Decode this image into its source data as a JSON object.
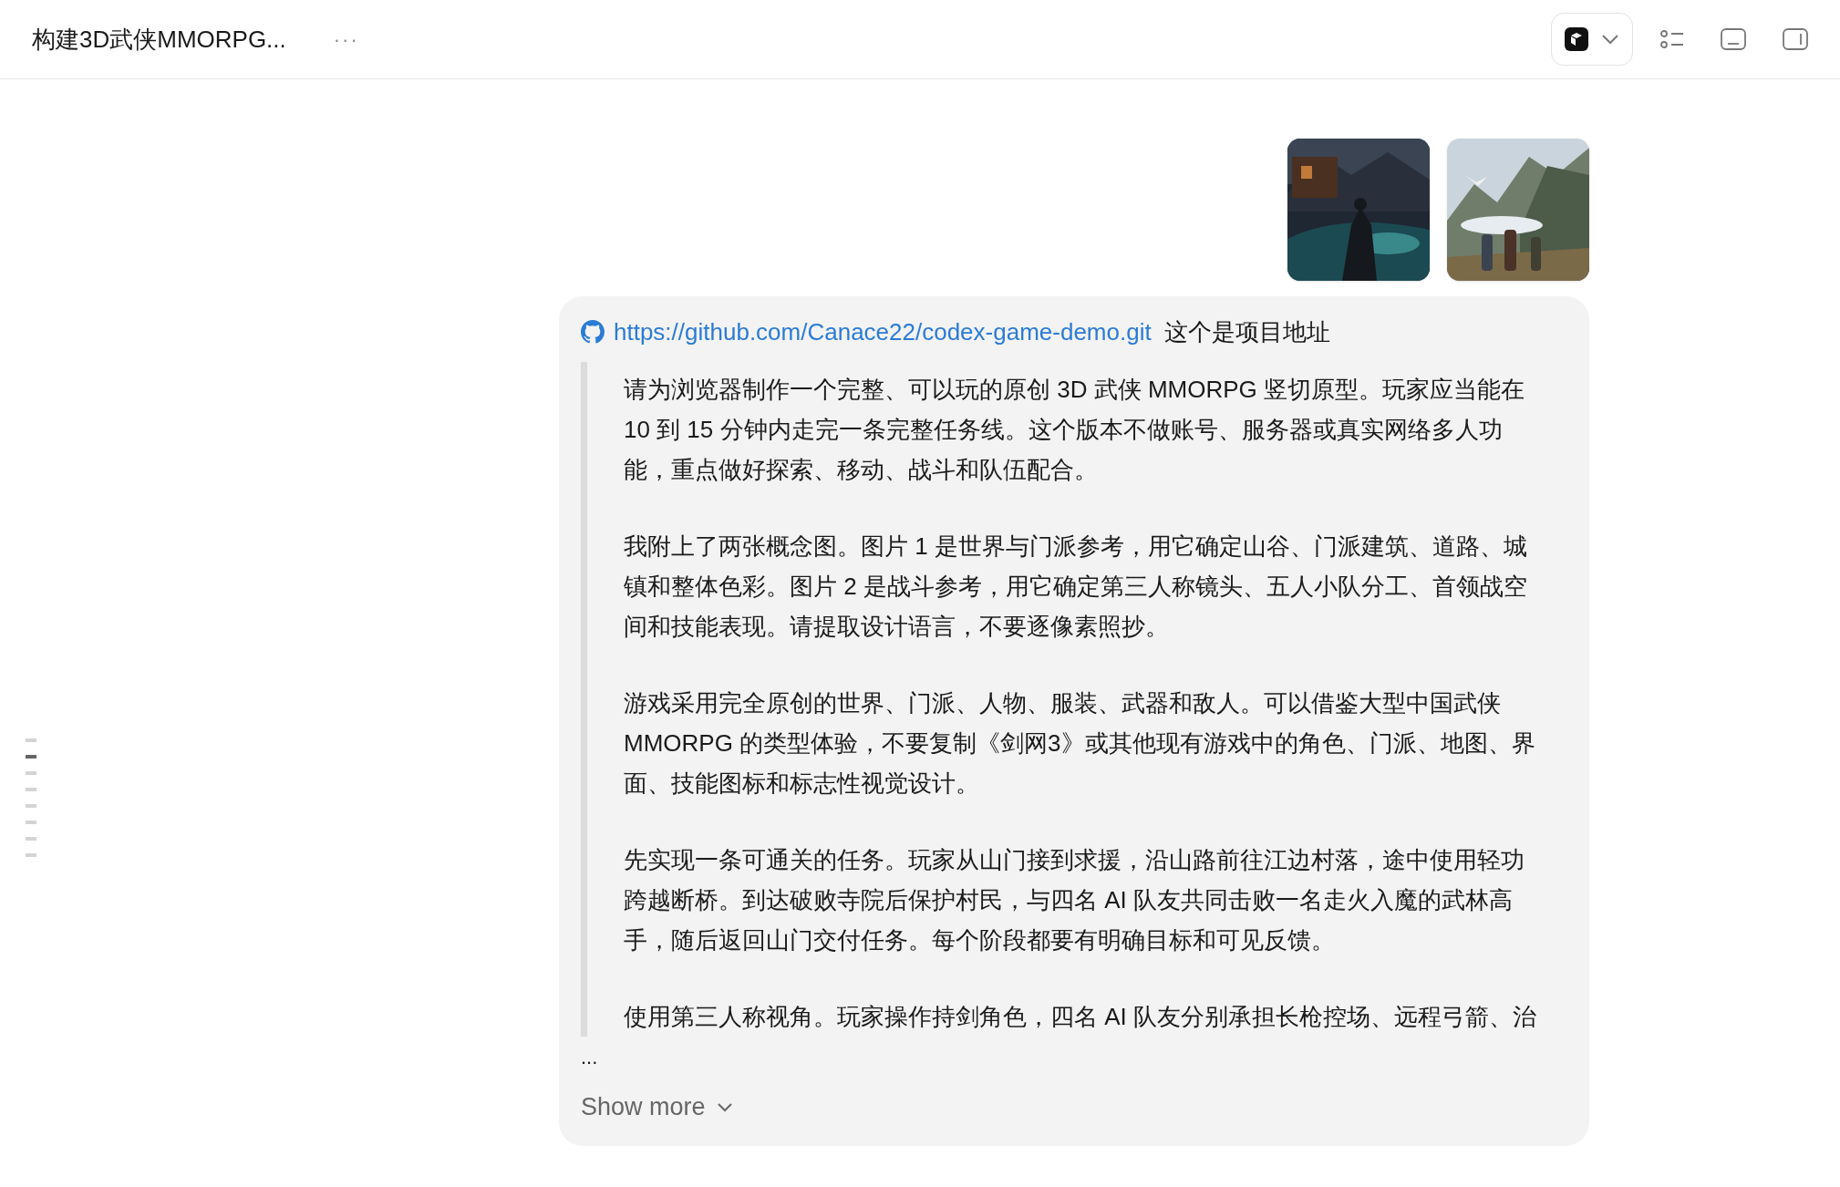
{
  "header": {
    "title": "构建3D武侠MMORPG...",
    "more": "···"
  },
  "message": {
    "link": "https://github.com/Canace22/codex-game-demo.git",
    "link_note": "这个是项目地址",
    "paragraphs": [
      [
        "请为浏览器制作一个完整、可以玩的原创 3D 武侠 MMORPG 竖切原型。玩家应当能在",
        "10 到 15 分钟内走完一条完整任务线。这个版本不做账号、服务器或真实网络多人功",
        "能，重点做好探索、移动、战斗和队伍配合。"
      ],
      [
        "我附上了两张概念图。图片 1 是世界与门派参考，用它确定山谷、门派建筑、道路、城",
        "镇和整体色彩。图片 2 是战斗参考，用它确定第三人称镜头、五人小队分工、首领战空",
        "间和技能表现。请提取设计语言，不要逐像素照抄。"
      ],
      [
        "游戏采用完全原创的世界、门派、人物、服装、武器和敌人。可以借鉴大型中国武侠",
        "MMORPG 的类型体验，不要复制《剑网3》或其他现有游戏中的角色、门派、地图、界",
        "面、技能图标和标志性视觉设计。"
      ],
      [
        "先实现一条可通关的任务。玩家从山门接到求援，沿山路前往江边村落，途中使用轻功",
        "跨越断桥。到达破败寺院后保护村民，与四名 AI 队友共同击败一名走火入魔的武林高",
        "手，随后返回山门交付任务。每个阶段都要有明确目标和可见反馈。"
      ],
      [
        "使用第三人称视角。玩家操作持剑角色，四名 AI 队友分别承担长枪控场、远程弓箭、治"
      ]
    ],
    "ellipsis": "...",
    "show_more": "Show more"
  },
  "outline_marks": [
    {
      "selected": false
    },
    {
      "selected": true
    },
    {
      "selected": false
    },
    {
      "selected": false
    },
    {
      "selected": false
    },
    {
      "selected": false
    },
    {
      "selected": false
    },
    {
      "selected": false
    }
  ]
}
